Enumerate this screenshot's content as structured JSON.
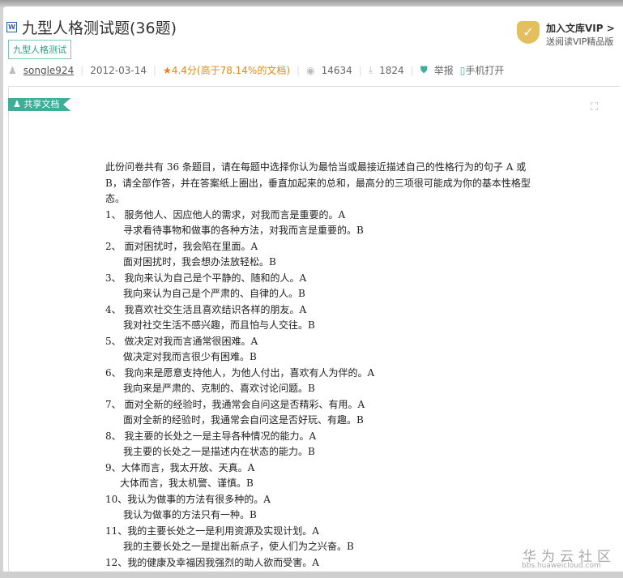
{
  "header": {
    "title": "九型人格测试题(36题)",
    "tag": "九型人格测试",
    "user": "songle924",
    "date": "2012-03-14",
    "rating": "4.4分(高于78.14%的文档)",
    "views": "14634",
    "downloads": "1824",
    "report": "举报",
    "mobile": "手机打开"
  },
  "vip": {
    "title": "加入文库VIP >",
    "subtitle": "送阅读VIP精品版"
  },
  "share_label": "共享文档",
  "doc": {
    "intro": "此份问卷共有 36 条题目，请在每题中选择你认为最恰当或最接近描述自己的性格行为的句子 A 或 B，请全部作答，并在答案纸上圈出，垂直加起来的总和，最高分的三项很可能成为你的基本性格型态。",
    "items": [
      {
        "a": "1、 服务他人、因应他人的需求，对我而言是重要的。A",
        "b": "寻求看待事物和做事的各种方法，对我而言是重要的。B"
      },
      {
        "a": "2、 面对困扰时，我会陷在里面。A",
        "b": "面对困扰时，我会想办法放轻松。B"
      },
      {
        "a": "3、 我向来认为自己是个平静的、随和的人。A",
        "b": "我向来认为自己是个严肃的、自律的人。B"
      },
      {
        "a": "4、 我喜欢社交生活且喜欢结识各样的朋友。A",
        "b": "我对社交生活不感兴趣，而且怕与人交往。B"
      },
      {
        "a": "5、 做决定对我而言通常很困难。A",
        "b": "做决定对我而言很少有困难。B"
      },
      {
        "a": "6、 我向来是愿意支持他人，为他人付出，喜欢有人为伴的。A",
        "b": "我向来是严肃的、克制的、喜欢讨论问题。B"
      },
      {
        "a": "7、 面对全新的经验时，我通常会自问这是否精彩、有用。A",
        "b": "面对全新的经验时，我通常会自问这是否好玩、有趣。B"
      },
      {
        "a": "8、 我主要的长处之一是主导各种情况的能力。A",
        "b": "我主要的长处之一是描述内在状态的能力。B"
      },
      {
        "a": "9、大体而言，我太开放、天真。A",
        "b": "大体而言，我太机警、谨慎。B"
      },
      {
        "a": "10、我认为做事的方法有很多种的。A",
        "b": "我认为做事的方法只有一种。B"
      },
      {
        "a": "11、我的主要长处之一是利用资源及实现计划。A",
        "b": "我的主要长处之一是提出新点子，使人们为之兴奋。B"
      },
      {
        "a": "12、我的健康及幸福因我强烈的助人欲而受害。A"
      }
    ]
  },
  "watermark": {
    "name": "华为云社区",
    "url": "bbs.huaweicloud.com"
  }
}
